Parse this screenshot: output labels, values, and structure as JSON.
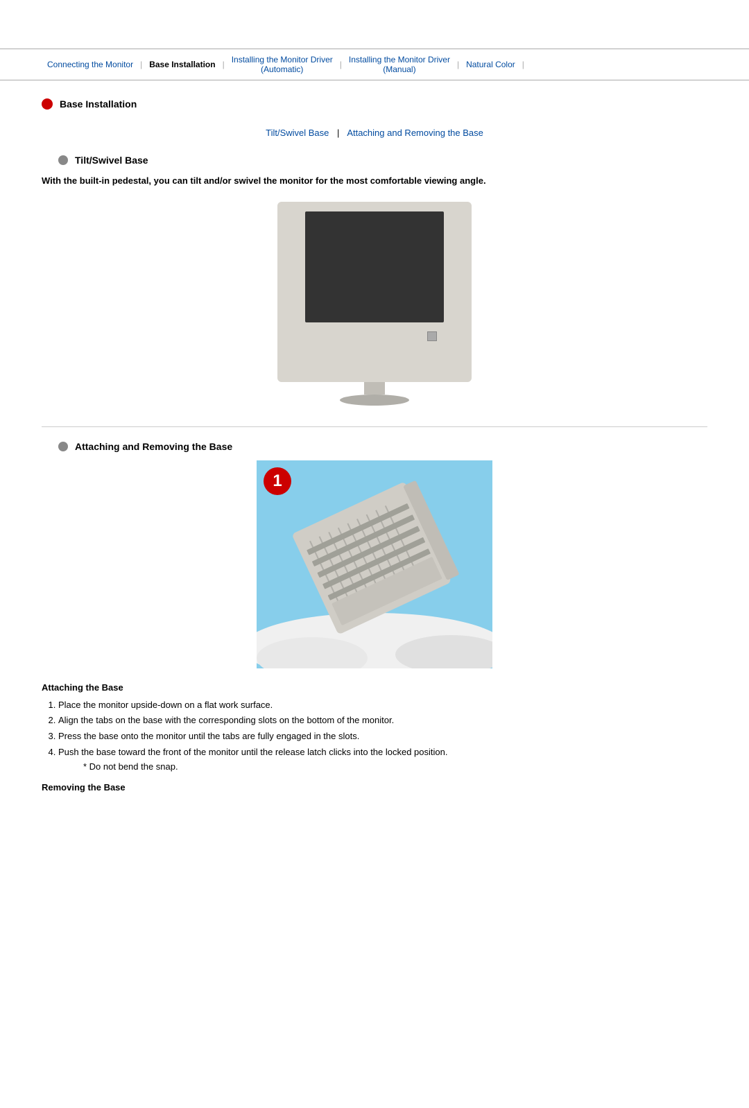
{
  "nav": {
    "items": [
      {
        "label": "Connecting the Monitor",
        "active": false,
        "id": "connecting"
      },
      {
        "label": "Base Installation",
        "active": true,
        "id": "base-installation"
      },
      {
        "label": "Installing the Monitor Driver\n(Automatic)",
        "active": false,
        "id": "driver-auto"
      },
      {
        "label": "Installing the Monitor Driver\n(Manual)",
        "active": false,
        "id": "driver-manual"
      },
      {
        "label": "Natural Color",
        "active": false,
        "id": "natural-color"
      }
    ]
  },
  "page": {
    "main_section_title": "Base Installation",
    "sub_nav": {
      "link1": "Tilt/Swivel Base",
      "separator": "|",
      "link2": "Attaching and Removing the Base"
    },
    "tilt_section": {
      "title": "Tilt/Swivel Base",
      "body": "With the built-in pedestal, you can tilt and/or swivel the monitor for the most comfortable viewing angle."
    },
    "attach_section": {
      "title": "Attaching and Removing the Base",
      "attaching_title": "Attaching the Base",
      "steps": [
        "Place the monitor upside-down on a flat work surface.",
        "Align the tabs on the base with the corresponding slots on the bottom of the monitor.",
        "Press the base onto the monitor until the tabs are fully engaged in the slots.",
        "Push the base toward the front of the monitor until the release latch clicks into the locked position."
      ],
      "note": "* Do not bend the snap.",
      "removing_title": "Removing the Base"
    }
  }
}
